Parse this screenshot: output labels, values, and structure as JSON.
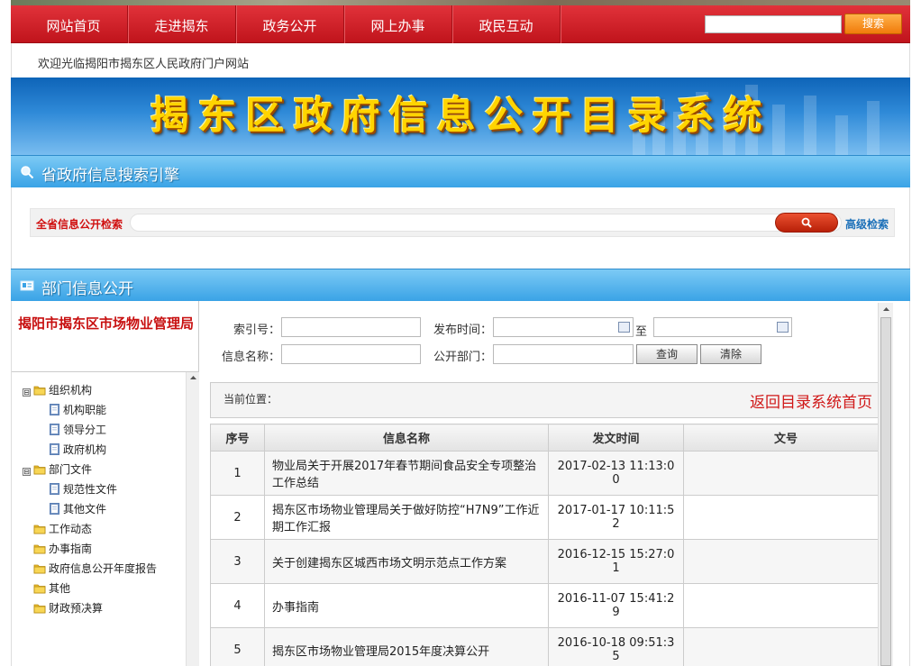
{
  "nav": {
    "items": [
      "网站首页",
      "走进揭东",
      "政务公开",
      "网上办事",
      "政民互动"
    ],
    "search_button": "搜索"
  },
  "welcome": "欢迎光临揭阳市揭东区人民政府门户网站",
  "banner": {
    "title": "揭东区政府信息公开目录系统"
  },
  "engine": {
    "header": "省政府信息搜索引擎",
    "label": "全省信息公开检索",
    "advanced": "高级检索",
    "icon": "magnifier-icon"
  },
  "dept": {
    "header": "部门信息公开",
    "org_title": "揭阳市揭东区市场物业管理局"
  },
  "tree": {
    "items": [
      {
        "label": "组织机构",
        "kind": "folder",
        "expander": "⊟"
      },
      {
        "label": "机构职能",
        "kind": "doc"
      },
      {
        "label": "领导分工",
        "kind": "doc"
      },
      {
        "label": "政府机构",
        "kind": "doc"
      },
      {
        "label": "部门文件",
        "kind": "folder",
        "expander": "⊟"
      },
      {
        "label": "规范性文件",
        "kind": "doc"
      },
      {
        "label": "其他文件",
        "kind": "doc"
      },
      {
        "label": "工作动态",
        "kind": "folder"
      },
      {
        "label": "办事指南",
        "kind": "folder"
      },
      {
        "label": "政府信息公开年度报告",
        "kind": "folder"
      },
      {
        "label": "其他",
        "kind": "folder"
      },
      {
        "label": "财政预决算",
        "kind": "folder"
      }
    ]
  },
  "form": {
    "index_no": "索引号：",
    "publish_time": "发布时间：",
    "to": "至",
    "info_name": "信息名称：",
    "dept": "公开部门：",
    "query": "查询",
    "clear": "清除"
  },
  "location": {
    "label": "当前位置：",
    "back": "返回目录系统首页"
  },
  "table": {
    "headers": [
      "序号",
      "信息名称",
      "发文时间",
      "文号"
    ],
    "rows": [
      [
        "1",
        "物业局关于开展2017年春节期间食品安全专项整治工作总结",
        "2017-02-13 11:13:00",
        ""
      ],
      [
        "2",
        "揭东区市场物业管理局关于做好防控“H7N9”工作近期工作汇报",
        "2017-01-17 10:11:52",
        ""
      ],
      [
        "3",
        "关于创建揭东区城西市场文明示范点工作方案",
        "2016-12-15 15:27:01",
        ""
      ],
      [
        "4",
        "办事指南",
        "2016-11-07 15:41:29",
        ""
      ],
      [
        "5",
        "揭东区市场物业管理局2015年度决算公开",
        "2016-10-18 09:51:35",
        ""
      ]
    ]
  },
  "colors": {
    "nav_red": "#c8161e",
    "accent_blue": "#3aa3e6",
    "search_orange": "#f07a0a",
    "title_red": "#c81010"
  }
}
